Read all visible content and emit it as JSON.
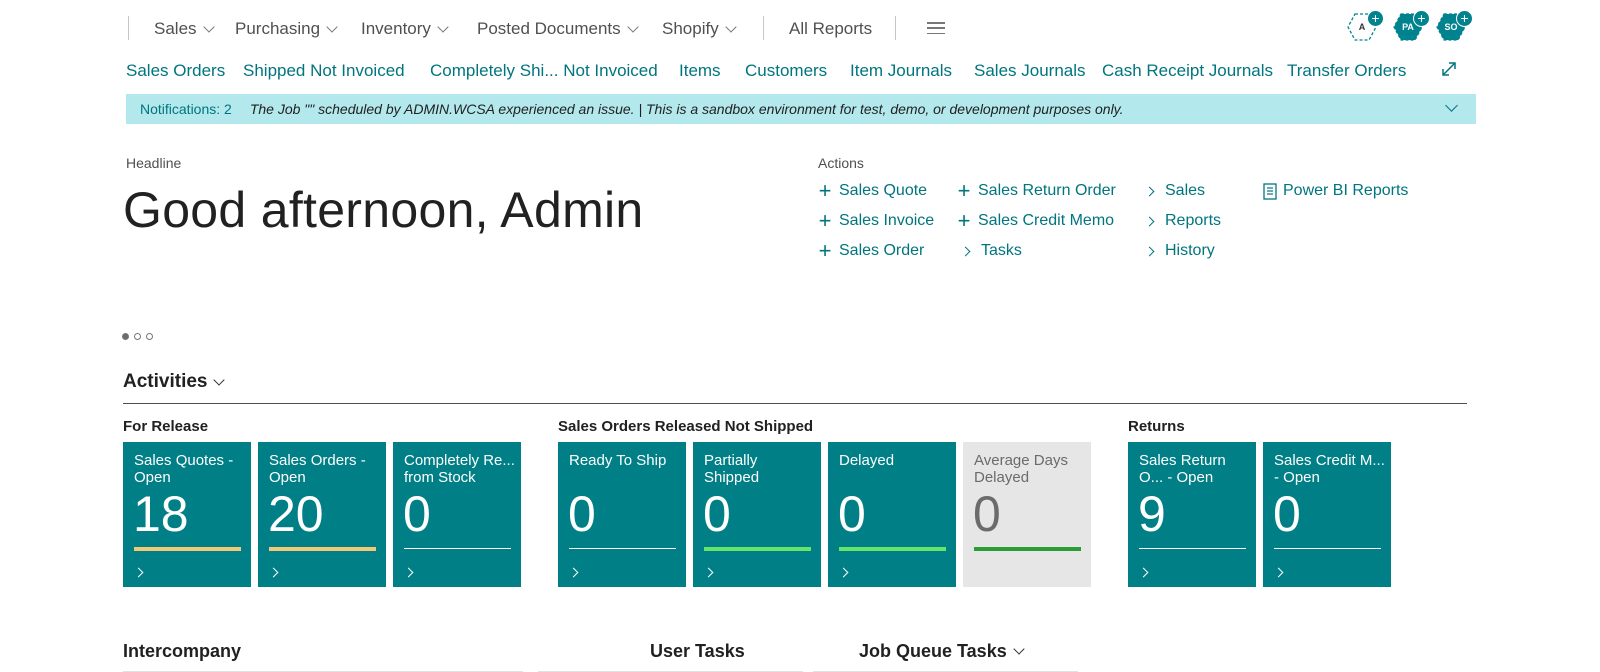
{
  "top_nav": {
    "items": [
      {
        "label": "Sales",
        "has_menu": true
      },
      {
        "label": "Purchasing",
        "has_menu": true
      },
      {
        "label": "Inventory",
        "has_menu": true
      },
      {
        "label": "Posted Documents",
        "has_menu": true
      },
      {
        "label": "Shopify",
        "has_menu": true
      },
      {
        "label": "All Reports",
        "has_menu": false
      }
    ],
    "more_icon": "hamburger-icon"
  },
  "avatars": [
    {
      "initials": "A",
      "style": "outline"
    },
    {
      "initials": "PA",
      "style": "filled"
    },
    {
      "initials": "SO",
      "style": "filled"
    }
  ],
  "links": [
    "Sales Orders",
    "Shipped Not Invoiced",
    "Completely Shi... Not Invoiced",
    "Items",
    "Customers",
    "Item Journals",
    "Sales Journals",
    "Cash Receipt Journals",
    "Transfer Orders"
  ],
  "notification": {
    "count_label": "Notifications: 2",
    "message": "The Job \"\" scheduled by ADMIN.WCSA experienced an issue.  |  This is a sandbox environment for test, demo, or development purposes only."
  },
  "headline": {
    "label": "Headline",
    "text": "Good afternoon, Admin"
  },
  "actions": {
    "label": "Actions",
    "new_items": [
      "Sales Quote",
      "Sales Invoice",
      "Sales Order",
      "Sales Return Order",
      "Sales Credit Memo"
    ],
    "menus": [
      "Tasks",
      "Sales",
      "Reports",
      "History"
    ],
    "report_link": "Power BI Reports"
  },
  "activities": {
    "title": "Activities",
    "groups": [
      {
        "title": "For Release",
        "tiles": [
          {
            "title": "Sales Quotes - Open",
            "value": "18",
            "bar_color": "#f2c979",
            "bar_thick": true,
            "style": "teal"
          },
          {
            "title": "Sales Orders - Open",
            "value": "20",
            "bar_color": "#f2c979",
            "bar_thick": true,
            "style": "teal"
          },
          {
            "title": "Completely Re... from Stock",
            "value": "0",
            "bar_color": "#ffffff",
            "bar_thick": false,
            "style": "teal"
          }
        ]
      },
      {
        "title": "Sales Orders Released Not Shipped",
        "tiles": [
          {
            "title": "Ready To Ship",
            "value": "0",
            "bar_color": "#ffffff",
            "bar_thick": false,
            "style": "teal"
          },
          {
            "title": "Partially Shipped",
            "value": "0",
            "bar_color": "#66e36b",
            "bar_thick": true,
            "style": "teal"
          },
          {
            "title": "Delayed",
            "value": "0",
            "bar_color": "#66e36b",
            "bar_thick": true,
            "style": "teal"
          },
          {
            "title": "Average Days Delayed",
            "value": "0",
            "bar_color": "#2a9d34",
            "bar_thick": true,
            "style": "grey"
          }
        ]
      },
      {
        "title": "Returns",
        "tiles": [
          {
            "title": "Sales Return O... - Open",
            "value": "9",
            "bar_color": "#ffffff",
            "bar_thick": false,
            "style": "teal"
          },
          {
            "title": "Sales Credit M... - Open",
            "value": "0",
            "bar_color": "#ffffff",
            "bar_thick": false,
            "style": "teal"
          }
        ]
      }
    ]
  },
  "bottom_sections": [
    {
      "title": "Intercompany",
      "has_menu": false
    },
    {
      "title": "User Tasks",
      "has_menu": false
    },
    {
      "title": "Job Queue Tasks",
      "has_menu": true
    }
  ],
  "colors": {
    "accent": "#00757f",
    "tile": "#007f86",
    "notification_bg": "#b3e8ec"
  }
}
